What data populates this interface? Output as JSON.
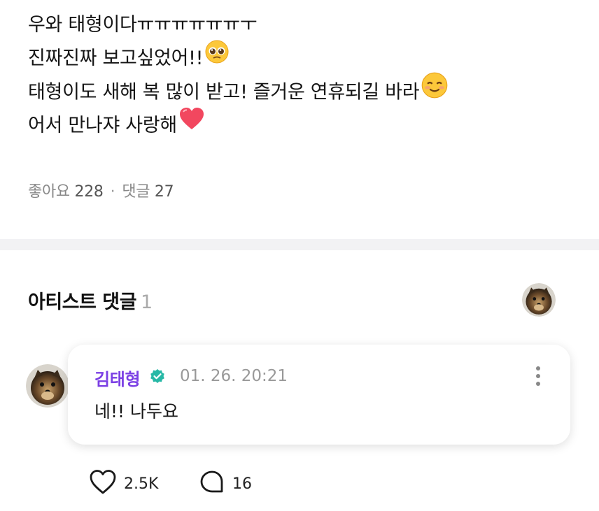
{
  "post": {
    "lines": [
      "우와 태형이다ㅠㅠㅠㅠㅠㅠㅜ",
      "진짜진짜 보고싶었어!!",
      "태형이도 새해 복 많이 받고! 즐거운 연휴되길 바라",
      "어서 만나쟈 사랑해"
    ],
    "emojis": [
      "pleading-face-icon",
      "smiling-face-icon",
      "red-heart-icon"
    ]
  },
  "stats": {
    "likes_label": "좋아요",
    "likes_count": "228",
    "separator": "·",
    "comments_label": "댓글",
    "comments_count": "27"
  },
  "artist_section": {
    "title": "아티스트 댓글",
    "count": "1"
  },
  "comment": {
    "author": "김태형",
    "timestamp": "01. 26. 20:21",
    "text": "네!! 나두요",
    "like_count": "2.5K",
    "reply_count": "16"
  },
  "colors": {
    "author_name": "#7b3fe4",
    "verified_badge": "#27b8a6",
    "divider": "#f2f2f4"
  }
}
